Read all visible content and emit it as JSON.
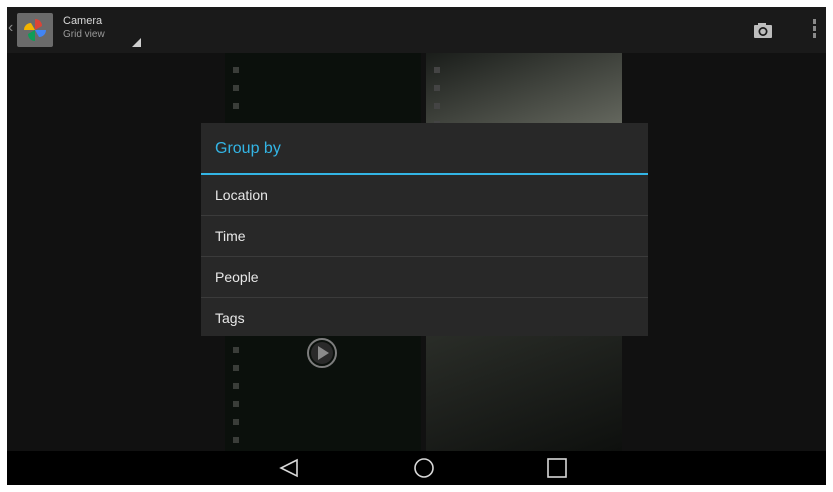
{
  "action_bar": {
    "title": "Camera",
    "subtitle": "Grid view",
    "icons": {
      "up": "chevron-left-icon",
      "app": "photos-pinwheel-icon",
      "camera": "camera-icon",
      "overflow": "overflow-menu-icon"
    }
  },
  "dialog": {
    "title": "Group by",
    "items": [
      "Location",
      "Time",
      "People",
      "Tags"
    ],
    "accent_color": "#33b5e5"
  },
  "content": {
    "icons": {
      "play": "play-icon"
    }
  },
  "nav_bar": {
    "icons": [
      "back-icon",
      "home-icon",
      "recent-apps-icon"
    ]
  }
}
